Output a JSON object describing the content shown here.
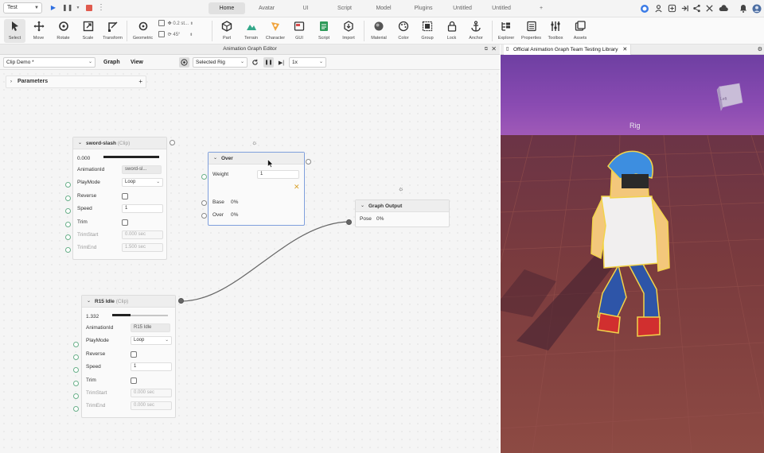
{
  "topbar": {
    "place": "Test",
    "tabs": [
      "Home",
      "Avatar",
      "UI",
      "Script",
      "Model",
      "Plugins",
      "Untitled",
      "Untitled",
      "+"
    ],
    "active_tab": "Home"
  },
  "ribbon": {
    "tools": [
      {
        "label": "Select",
        "icon": "cursor-icon"
      },
      {
        "label": "Move",
        "icon": "move-icon"
      },
      {
        "label": "Rotate",
        "icon": "rotate-icon"
      },
      {
        "label": "Scale",
        "icon": "scale-icon"
      },
      {
        "label": "Transform",
        "icon": "transform-icon"
      },
      {
        "label": "Geometric",
        "icon": "geometric-icon"
      },
      {
        "label": "Part",
        "icon": "part-icon"
      },
      {
        "label": "Terrain",
        "icon": "terrain-icon"
      },
      {
        "label": "Character",
        "icon": "character-icon"
      },
      {
        "label": "GUI",
        "icon": "gui-icon"
      },
      {
        "label": "Script",
        "icon": "script-icon"
      },
      {
        "label": "Import",
        "icon": "import-icon"
      },
      {
        "label": "Material",
        "icon": "material-icon"
      },
      {
        "label": "Color",
        "icon": "color-icon"
      },
      {
        "label": "Group",
        "icon": "group-icon"
      },
      {
        "label": "Lock",
        "icon": "lock-icon"
      },
      {
        "label": "Anchor",
        "icon": "anchor-icon"
      },
      {
        "label": "Explorer",
        "icon": "explorer-icon"
      },
      {
        "label": "Properties",
        "icon": "properties-icon"
      },
      {
        "label": "Toolbox",
        "icon": "toolbox-icon"
      },
      {
        "label": "Assets",
        "icon": "assets-icon"
      }
    ],
    "move_step": "0.2 st...",
    "rotate_step": "45°"
  },
  "editor": {
    "title": "Animation Graph Editor",
    "clip_select": "Clip Demo *",
    "graph_label": "Graph",
    "view_label": "View",
    "target_select": "Selected Rig",
    "speed_select": "1x",
    "parameters_label": "Parameters",
    "parameters_add": "+"
  },
  "nodes": {
    "sword": {
      "title": "sword-slash",
      "type": "(Clip)",
      "time": "0.000",
      "rows": {
        "animation_id_label": "AnimationId",
        "animation_id_value": "sword-sl...",
        "playmode_label": "PlayMode",
        "playmode_value": "Loop",
        "reverse_label": "Reverse",
        "speed_label": "Speed",
        "speed_value": "1",
        "trim_label": "Trim",
        "trimstart_label": "TrimStart",
        "trimstart_value": "0.000 sec",
        "trimend_label": "TrimEnd",
        "trimend_value": "1.500 sec"
      }
    },
    "idle": {
      "title": "R15 Idle",
      "type": "(Clip)",
      "time": "1.332",
      "progress": 0.33,
      "rows": {
        "animation_id_label": "AnimationId",
        "animation_id_value": "R15 Idle",
        "playmode_label": "PlayMode",
        "playmode_value": "Loop",
        "reverse_label": "Reverse",
        "speed_label": "Speed",
        "speed_value": "1",
        "trim_label": "Trim",
        "trimstart_label": "TrimStart",
        "trimstart_value": "0.000 sec",
        "trimend_label": "TrimEnd",
        "trimend_value": "0.000 sec"
      }
    },
    "over": {
      "title": "Over",
      "weight_label": "Weight",
      "weight_value": "1",
      "base_label": "Base",
      "base_value": "0%",
      "over_label": "Over",
      "over_value": "0%"
    },
    "output": {
      "title": "Graph Output",
      "pose_label": "Pose",
      "pose_value": "0%"
    }
  },
  "viewport": {
    "tab_title": "Official Animation Graph Team Testing Library",
    "rig_label": "Rig",
    "cube_label": "Left"
  },
  "colors": {
    "accent": "#3b7be6",
    "selection_border": "#7f9fdc",
    "pin_green": "#6ab08a",
    "sky_top": "#6e3fa2",
    "floor": "#7a3b3e"
  }
}
